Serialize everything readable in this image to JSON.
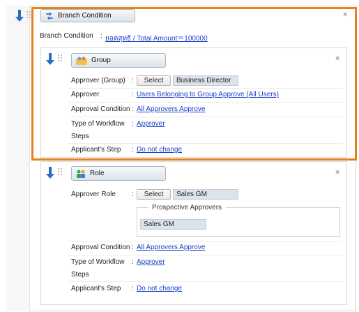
{
  "branch": {
    "header_label": "Branch Condition",
    "condition_label": "Branch Condition",
    "condition_colon": ":",
    "condition_value": "ยอดสุทธิ / Total Amount＝100000",
    "close": "×"
  },
  "group_step": {
    "header_label": "Group",
    "close": "×",
    "rows": [
      {
        "label": "Approver (Group)",
        "colon": ":",
        "select_label": "Select",
        "value": "Business Director"
      },
      {
        "label": "Approver",
        "colon": ":",
        "link": "Users Belonging to Group Approve (All Users)"
      },
      {
        "label": "Approval Condition",
        "colon": ":",
        "link": "All Approvers Approve"
      },
      {
        "label_line1": "Type of Workflow",
        "label_line2": "Steps",
        "colon": ":",
        "link": "Approver"
      },
      {
        "label": "Applicant's Step",
        "colon": ":",
        "link": "Do not change"
      }
    ]
  },
  "role_step": {
    "header_label": "Role",
    "close": "×",
    "approver_role_label": "Approver Role",
    "approver_role_colon": ":",
    "select_label": "Select",
    "role_value": "Sales GM",
    "prospective_legend": "Prospective Approvers",
    "prospective_value": "Sales GM",
    "rows": [
      {
        "label": "Approval Condition",
        "colon": ":",
        "link": "All Approvers Approve"
      },
      {
        "label_line1": "Type of Workflow",
        "label_line2": "Steps",
        "colon": ":",
        "link": "Approver"
      },
      {
        "label": "Applicant's Step",
        "colon": ":",
        "link": "Do not change"
      }
    ]
  },
  "colors": {
    "highlight": "#e8801e",
    "link": "#1a3fc7",
    "arrow": "#2a6bc4",
    "value_box": "#dde3ea"
  },
  "icons": [
    "down-arrow-icon",
    "drag-handle-icon",
    "branch-icon",
    "group-icon",
    "role-icon",
    "close-icon"
  ]
}
